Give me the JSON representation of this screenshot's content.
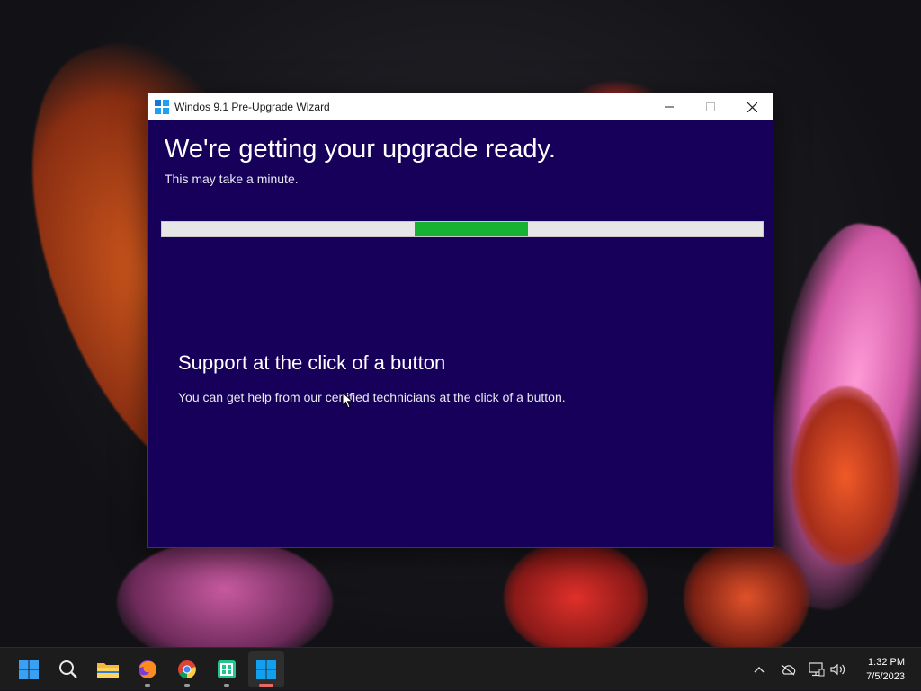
{
  "window": {
    "title": "Windos 9.1 Pre-Upgrade Wizard",
    "heading": "We're getting your upgrade ready.",
    "subheading": "This may take a minute.",
    "progress": {
      "indeterminate_segment_start": 0.42,
      "indeterminate_segment_end": 0.61,
      "color": "#17b233"
    },
    "support_title": "Support at the click of a button",
    "support_text": "You can get help from our certified technicians at the click of a button.",
    "background_color": "#16005a"
  },
  "taskbar": {
    "items": [
      {
        "name": "start",
        "icon": "windows-start-icon"
      },
      {
        "name": "search",
        "icon": "search-icon"
      },
      {
        "name": "file-explorer",
        "icon": "folder-icon"
      },
      {
        "name": "firefox",
        "icon": "firefox-icon"
      },
      {
        "name": "chrome",
        "icon": "chrome-icon"
      },
      {
        "name": "app",
        "icon": "green-app-icon"
      },
      {
        "name": "wizard",
        "icon": "windows-app-icon",
        "active": true
      }
    ],
    "tray": [
      "chevron-up-icon",
      "network-off-icon",
      "display-icon",
      "volume-icon"
    ],
    "time": "1:32 PM",
    "date": "7/5/2023"
  }
}
